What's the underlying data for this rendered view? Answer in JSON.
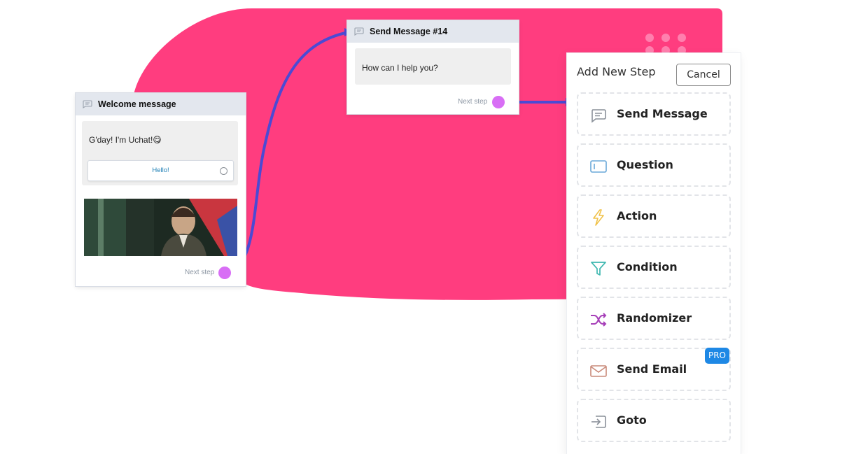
{
  "colors": {
    "brand_pink": "#ff3d7f",
    "connector": "#4b4ad4",
    "port": "#d86ef5",
    "pro_badge": "#1e88e5"
  },
  "welcome_card": {
    "title": "Welcome message",
    "icon": "message-icon",
    "text": "G'day! I'm Uchat!😋",
    "quick_reply": "Hello!",
    "next_step": "Next step"
  },
  "send_card": {
    "title": "Send Message #14",
    "icon": "message-icon",
    "text": "How can I help you?",
    "next_step": "Next step"
  },
  "panel": {
    "title": "Add New Step",
    "cancel_label": "Cancel",
    "steps": [
      {
        "label": "Send Message",
        "icon": "message-icon"
      },
      {
        "label": "Question",
        "icon": "input-field-icon"
      },
      {
        "label": "Action",
        "icon": "lightning-icon"
      },
      {
        "label": "Condition",
        "icon": "filter-icon"
      },
      {
        "label": "Randomizer",
        "icon": "shuffle-icon"
      },
      {
        "label": "Send Email",
        "icon": "envelope-icon",
        "badge": "PRO"
      },
      {
        "label": "Goto",
        "icon": "goto-icon"
      }
    ]
  }
}
